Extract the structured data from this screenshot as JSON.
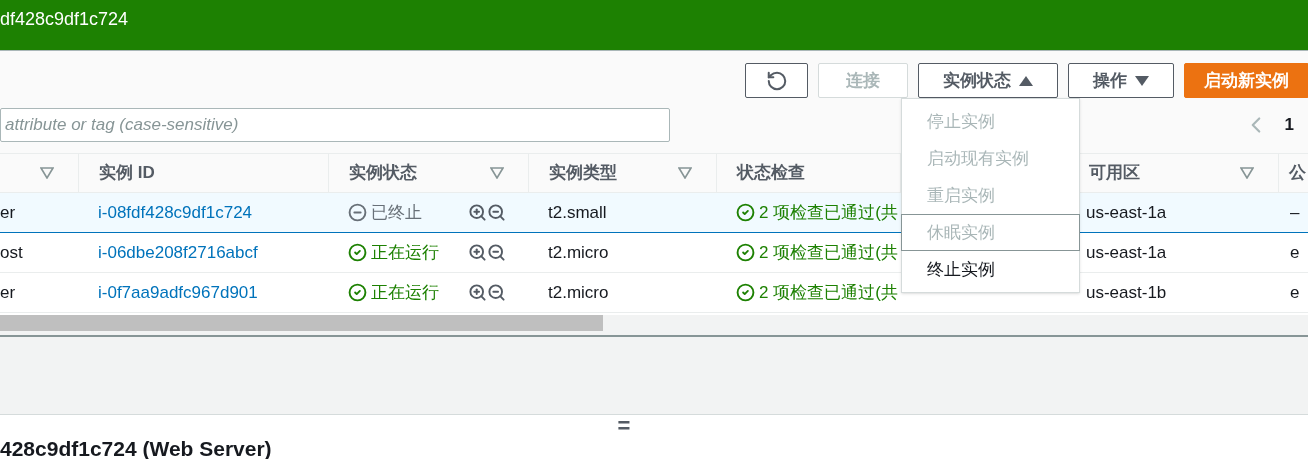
{
  "header": {
    "title": "df428c9df1c724"
  },
  "toolbar": {
    "buttons": [
      {
        "kind": "refresh"
      },
      {
        "kind": "plain",
        "label": "连接",
        "disabled": true
      },
      {
        "kind": "dropdown",
        "label": "实例状态",
        "expanded": true
      },
      {
        "kind": "dropdown",
        "label": "操作",
        "expanded": false
      },
      {
        "kind": "primary",
        "label": "启动新实例"
      }
    ]
  },
  "search": {
    "placeholder": "attribute or tag (case-sensitive)"
  },
  "pagination": {
    "page": "1"
  },
  "menu": {
    "items": [
      {
        "label": "停止实例",
        "disabled": true,
        "focused": false
      },
      {
        "label": "启动现有实例",
        "disabled": true,
        "focused": false
      },
      {
        "label": "重启实例",
        "disabled": true,
        "focused": false
      },
      {
        "label": "休眠实例",
        "disabled": true,
        "focused": true
      },
      {
        "label": "终止实例",
        "disabled": false,
        "focused": false
      }
    ]
  },
  "table": {
    "columns": [
      {
        "filter": true
      },
      {
        "label": "实例 ID",
        "filter": false
      },
      {
        "label": "实例状态",
        "filter": true
      },
      {
        "label": "实例类型",
        "filter": true
      },
      {
        "label": "状态检查",
        "filter": false
      },
      {
        "filter": false
      },
      {
        "label": "可用区",
        "filter": true
      },
      {
        "label": "公",
        "filter": false
      }
    ],
    "rows": [
      {
        "selected": true,
        "name": "er",
        "id": "i-08fdf428c9df1c724",
        "state": {
          "label": "已终止",
          "kind": "stopped"
        },
        "type": "t2.small",
        "check": "2 项检查已通过(共",
        "zone": "us-east-1a",
        "public": "–"
      },
      {
        "selected": false,
        "name": "ost",
        "id": "i-06dbe208f2716abcf",
        "state": {
          "label": "正在运行",
          "kind": "running"
        },
        "type": "t2.micro",
        "check": "2 项检查已通过(共",
        "zone": "us-east-1a",
        "public": "e"
      },
      {
        "selected": false,
        "name": "er",
        "id": "i-0f7aa9adfc967d901",
        "state": {
          "label": "正在运行",
          "kind": "running"
        },
        "type": "t2.micro",
        "check": "2 项检查已通过(共",
        "zone": "us-east-1b",
        "public": "e"
      }
    ]
  },
  "details": {
    "title": "428c9df1c724 (Web Server)",
    "handle": "="
  }
}
